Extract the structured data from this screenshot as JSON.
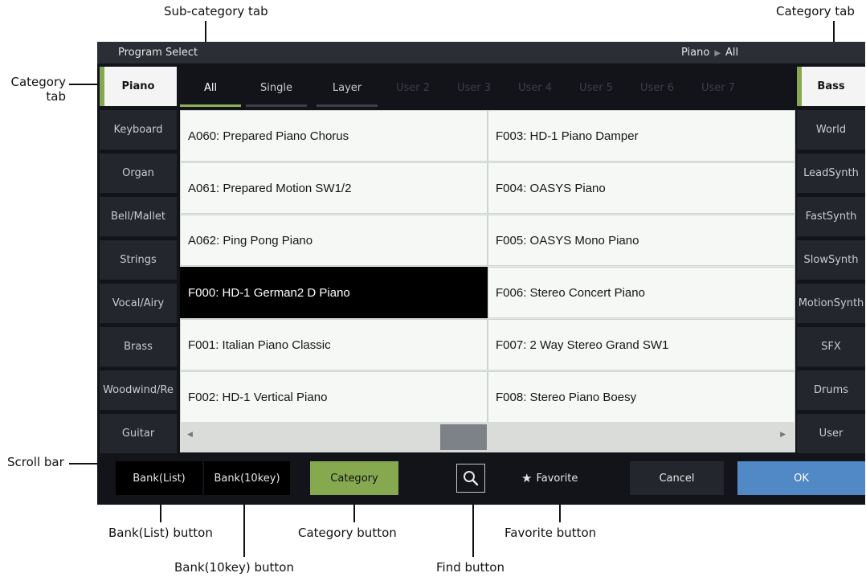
{
  "annotations": {
    "subcategory_tab": "Sub-category tab",
    "category_tab_right": "Category tab",
    "category_tab_left_line1": "Category",
    "category_tab_left_line2": "tab",
    "scroll_bar": "Scroll bar",
    "bank_list_button": "Bank(List) button",
    "bank_10key_button": "Bank(10key) button",
    "category_button": "Category button",
    "find_button": "Find button",
    "favorite_button": "Favorite button"
  },
  "screen": {
    "title": "Program Select",
    "breadcrumb": {
      "category": "Piano",
      "subcategory": "All"
    }
  },
  "left_categories": [
    {
      "label": "Piano",
      "selected": true
    },
    {
      "label": "Keyboard",
      "selected": false
    },
    {
      "label": "Organ",
      "selected": false
    },
    {
      "label": "Bell/Mallet",
      "selected": false
    },
    {
      "label": "Strings",
      "selected": false
    },
    {
      "label": "Vocal/Airy",
      "selected": false
    },
    {
      "label": "Brass",
      "selected": false
    },
    {
      "label": "Woodwind/Re",
      "selected": false
    },
    {
      "label": "Guitar",
      "selected": false
    }
  ],
  "right_categories": [
    {
      "label": "Bass",
      "selected": true
    },
    {
      "label": "World",
      "selected": false
    },
    {
      "label": "LeadSynth",
      "selected": false
    },
    {
      "label": "FastSynth",
      "selected": false
    },
    {
      "label": "SlowSynth",
      "selected": false
    },
    {
      "label": "MotionSynth",
      "selected": false
    },
    {
      "label": "SFX",
      "selected": false
    },
    {
      "label": "Drums",
      "selected": false
    },
    {
      "label": "User",
      "selected": false
    }
  ],
  "subtabs": [
    {
      "label": "All",
      "state": "selected"
    },
    {
      "label": "Single",
      "state": "normal"
    },
    {
      "label": "Layer",
      "state": "normal"
    },
    {
      "label": "User 2",
      "state": "disabled"
    },
    {
      "label": "User 3",
      "state": "disabled"
    },
    {
      "label": "User 4",
      "state": "disabled"
    },
    {
      "label": "User 5",
      "state": "disabled"
    },
    {
      "label": "User 6",
      "state": "disabled"
    },
    {
      "label": "User 7",
      "state": "disabled"
    }
  ],
  "programs": [
    {
      "label": "A060: Prepared Piano Chorus",
      "selected": false
    },
    {
      "label": "A061: Prepared Motion SW1/2",
      "selected": false
    },
    {
      "label": "A062: Ping Pong Piano",
      "selected": false
    },
    {
      "label": "F000: HD-1 German2 D Piano",
      "selected": true
    },
    {
      "label": "F001: Italian Piano Classic",
      "selected": false
    },
    {
      "label": "F002: HD-1 Vertical Piano",
      "selected": false
    },
    {
      "label": "F003: HD-1 Piano Damper",
      "selected": false
    },
    {
      "label": "F004: OASYS Piano",
      "selected": false
    },
    {
      "label": "F005: OASYS Mono Piano",
      "selected": false
    },
    {
      "label": "F006: Stereo Concert Piano",
      "selected": false
    },
    {
      "label": "F007: 2 Way Stereo Grand SW1",
      "selected": false
    },
    {
      "label": "F008: Stereo Piano Boesy",
      "selected": false
    }
  ],
  "bottom": {
    "bank_list": "Bank(List)",
    "bank_10key": "Bank(10key)",
    "category": "Category",
    "favorite": "Favorite",
    "cancel": "Cancel",
    "ok": "OK"
  },
  "icons": {
    "find": "magnifier-icon",
    "favorite": "star-icon",
    "breadcrumb_separator": "triangle-right-icon",
    "scroll_left": "arrow-left-icon",
    "scroll_right": "arrow-right-icon"
  },
  "colors": {
    "selected_accent": "#86a94f",
    "ok_button": "#5188c6",
    "selected_program_bg": "#000000"
  }
}
